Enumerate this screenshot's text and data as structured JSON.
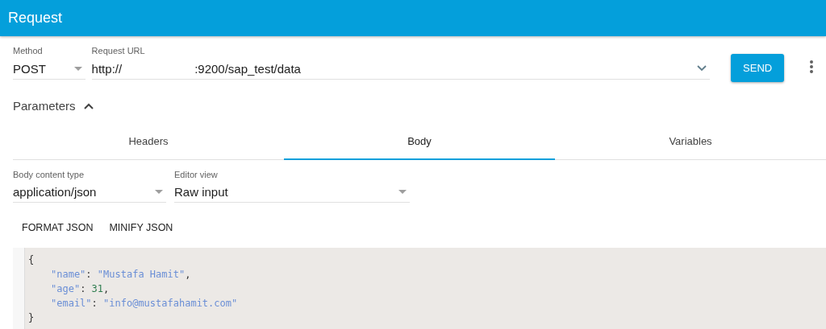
{
  "header": {
    "title": "Request"
  },
  "method": {
    "label": "Method",
    "value": "POST"
  },
  "url": {
    "label": "Request URL",
    "parts": [
      "http://",
      ":9200/sap_test/data"
    ]
  },
  "send_button": "SEND",
  "parameters": {
    "label": "Parameters",
    "expanded": true
  },
  "tabs": [
    {
      "label": "Headers",
      "selected": false
    },
    {
      "label": "Body",
      "selected": true
    },
    {
      "label": "Variables",
      "selected": false
    }
  ],
  "body_content_type": {
    "label": "Body content type",
    "value": "application/json"
  },
  "editor_view": {
    "label": "Editor view",
    "value": "Raw input"
  },
  "actions": [
    "FORMAT JSON",
    "MINIFY JSON"
  ],
  "code": {
    "open": "{",
    "entries": [
      {
        "kind": "string",
        "key": "\"name\"",
        "sep": ":",
        "value": "\"Mustafa Hamit\"",
        "trail": ","
      },
      {
        "kind": "number",
        "key": "\"age\"",
        "sep": ":",
        "value": "31",
        "trail": ","
      },
      {
        "kind": "string",
        "key": "\"email\"",
        "sep": ":",
        "value": "\"info@mustafahamit.com\""
      }
    ],
    "close": "}"
  }
}
